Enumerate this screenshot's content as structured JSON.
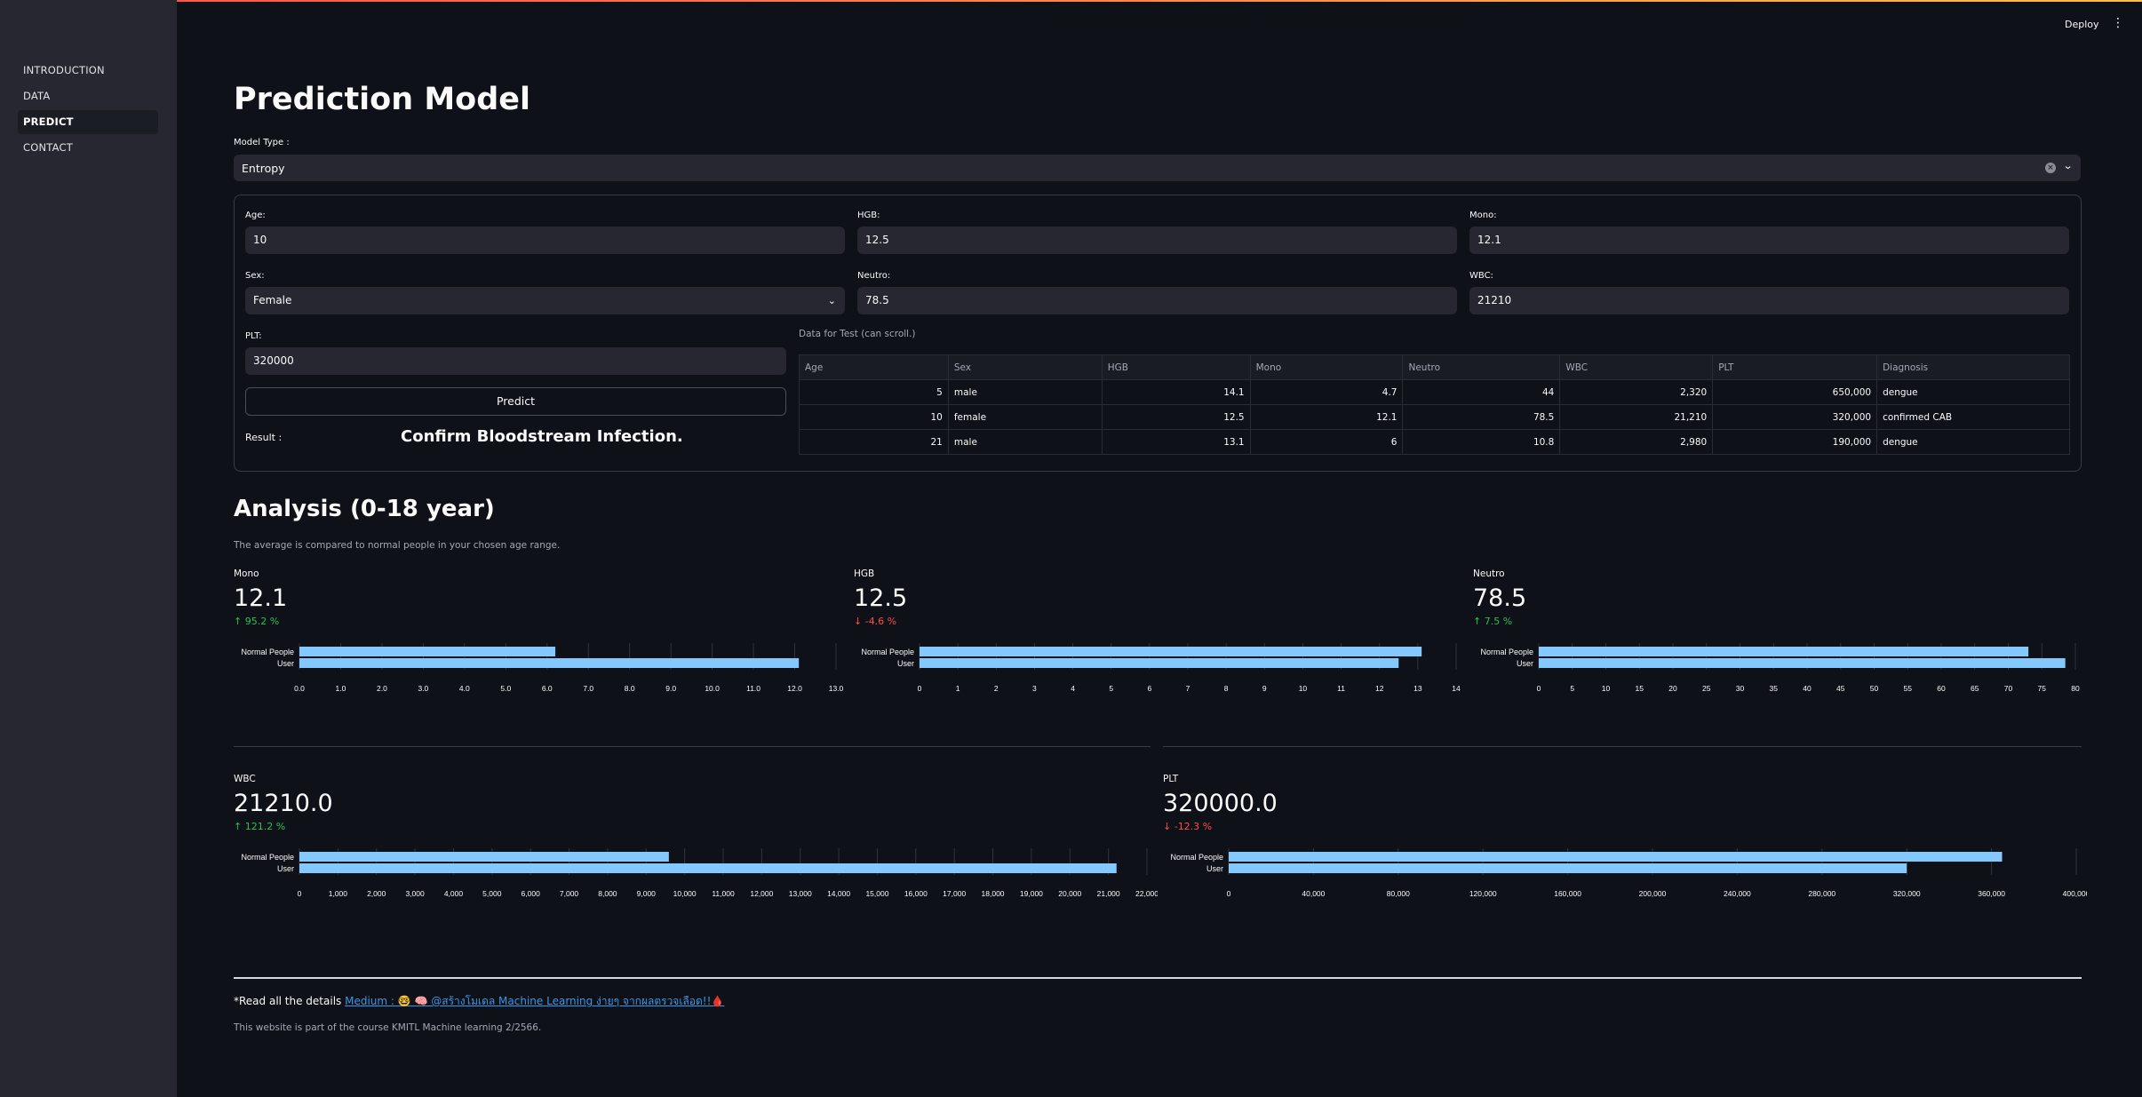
{
  "app": {
    "deploy_label": "Deploy",
    "menu_icon": "kebab-menu-icon"
  },
  "sidebar": {
    "items": [
      {
        "label": "INTRODUCTION",
        "active": false
      },
      {
        "label": "DATA",
        "active": false
      },
      {
        "label": "PREDICT",
        "active": true
      },
      {
        "label": "CONTACT",
        "active": false
      }
    ]
  },
  "page": {
    "title": "Prediction Model"
  },
  "model_type": {
    "label": "Model Type :",
    "value": "Entropy"
  },
  "form": {
    "age": {
      "label": "Age:",
      "value": "10"
    },
    "hgb": {
      "label": "HGB:",
      "value": "12.5"
    },
    "mono": {
      "label": "Mono:",
      "value": "12.1"
    },
    "sex": {
      "label": "Sex:",
      "value": "Female"
    },
    "neutro": {
      "label": "Neutro:",
      "value": "78.5"
    },
    "wbc": {
      "label": "WBC:",
      "value": "21210"
    },
    "plt": {
      "label": "PLT:",
      "value": "320000"
    },
    "predict_label": "Predict",
    "result_label": "Result :",
    "result_text": "Confirm Bloodstream Infection."
  },
  "test_table": {
    "caption": "Data for Test (can scroll.)",
    "columns": [
      "Age",
      "Sex",
      "HGB",
      "Mono",
      "Neutro",
      "WBC",
      "PLT",
      "Diagnosis"
    ],
    "rows": [
      [
        "5",
        "male",
        "14.1",
        "4.7",
        "44",
        "2,320",
        "650,000",
        "dengue"
      ],
      [
        "10",
        "female",
        "12.5",
        "12.1",
        "78.5",
        "21,210",
        "320,000",
        "confirmed CAB"
      ],
      [
        "21",
        "male",
        "13.1",
        "6",
        "10.8",
        "2,980",
        "190,000",
        "dengue"
      ]
    ]
  },
  "analysis": {
    "title": "Analysis (0-18 year)",
    "caption": "The average is compared to normal people in your chosen age range."
  },
  "metrics": [
    {
      "label": "Mono",
      "value": "12.1",
      "delta": "95.2 %",
      "direction": "up"
    },
    {
      "label": "HGB",
      "value": "12.5",
      "delta": "-4.6 %",
      "direction": "down"
    },
    {
      "label": "Neutro",
      "value": "78.5",
      "delta": "7.5 %",
      "direction": "up"
    },
    {
      "label": "WBC",
      "value": "21210.0",
      "delta": "121.2 %",
      "direction": "up"
    },
    {
      "label": "PLT",
      "value": "320000.0",
      "delta": "-12.3 %",
      "direction": "down"
    }
  ],
  "colors": {
    "bar": "#83c9ff",
    "up": "#21c354",
    "down": "#ff4b4b"
  },
  "chart_data": [
    {
      "type": "bar",
      "orientation": "horizontal",
      "categories": [
        "Normal People",
        "User"
      ],
      "values": [
        6.2,
        12.1
      ],
      "xlim": [
        0,
        13
      ],
      "ticks": [
        "0.0",
        "1.0",
        "2.0",
        "3.0",
        "4.0",
        "5.0",
        "6.0",
        "7.0",
        "8.0",
        "9.0",
        "10.0",
        "11.0",
        "12.0",
        "13.0"
      ]
    },
    {
      "type": "bar",
      "orientation": "horizontal",
      "categories": [
        "Normal People",
        "User"
      ],
      "values": [
        13.1,
        12.5
      ],
      "xlim": [
        0,
        14
      ],
      "ticks": [
        "0",
        "1",
        "2",
        "3",
        "4",
        "5",
        "6",
        "7",
        "8",
        "9",
        "10",
        "11",
        "12",
        "13",
        "14"
      ]
    },
    {
      "type": "bar",
      "orientation": "horizontal",
      "categories": [
        "Normal People",
        "User"
      ],
      "values": [
        73,
        78.5
      ],
      "xlim": [
        0,
        80
      ],
      "ticks": [
        "0",
        "5",
        "10",
        "15",
        "20",
        "25",
        "30",
        "35",
        "40",
        "45",
        "50",
        "55",
        "60",
        "65",
        "70",
        "75",
        "80"
      ]
    },
    {
      "type": "bar",
      "orientation": "horizontal",
      "categories": [
        "Normal People",
        "User"
      ],
      "values": [
        9590,
        21210
      ],
      "xlim": [
        0,
        22000
      ],
      "ticks": [
        "0",
        "1,000",
        "2,000",
        "3,000",
        "4,000",
        "5,000",
        "6,000",
        "7,000",
        "8,000",
        "9,000",
        "10,000",
        "11,000",
        "12,000",
        "13,000",
        "14,000",
        "15,000",
        "16,000",
        "17,000",
        "18,000",
        "19,000",
        "20,000",
        "21,000",
        "22,000"
      ]
    },
    {
      "type": "bar",
      "orientation": "horizontal",
      "categories": [
        "Normal People",
        "User"
      ],
      "values": [
        365000,
        320000
      ],
      "xlim": [
        0,
        400000
      ],
      "ticks": [
        "0",
        "40,000",
        "80,000",
        "120,000",
        "160,000",
        "200,000",
        "240,000",
        "280,000",
        "320,000",
        "360,000",
        "400,000"
      ]
    }
  ],
  "footer": {
    "read_prefix": "*Read all the details ",
    "link_text": "Medium : 🤓 🧠 @สร้างโมเดล Machine Learning ง่ายๆ จากผลตรวจเลือด!!🩸",
    "course_note": "This website is part of the course KMITL Machine learning 2/2566."
  }
}
